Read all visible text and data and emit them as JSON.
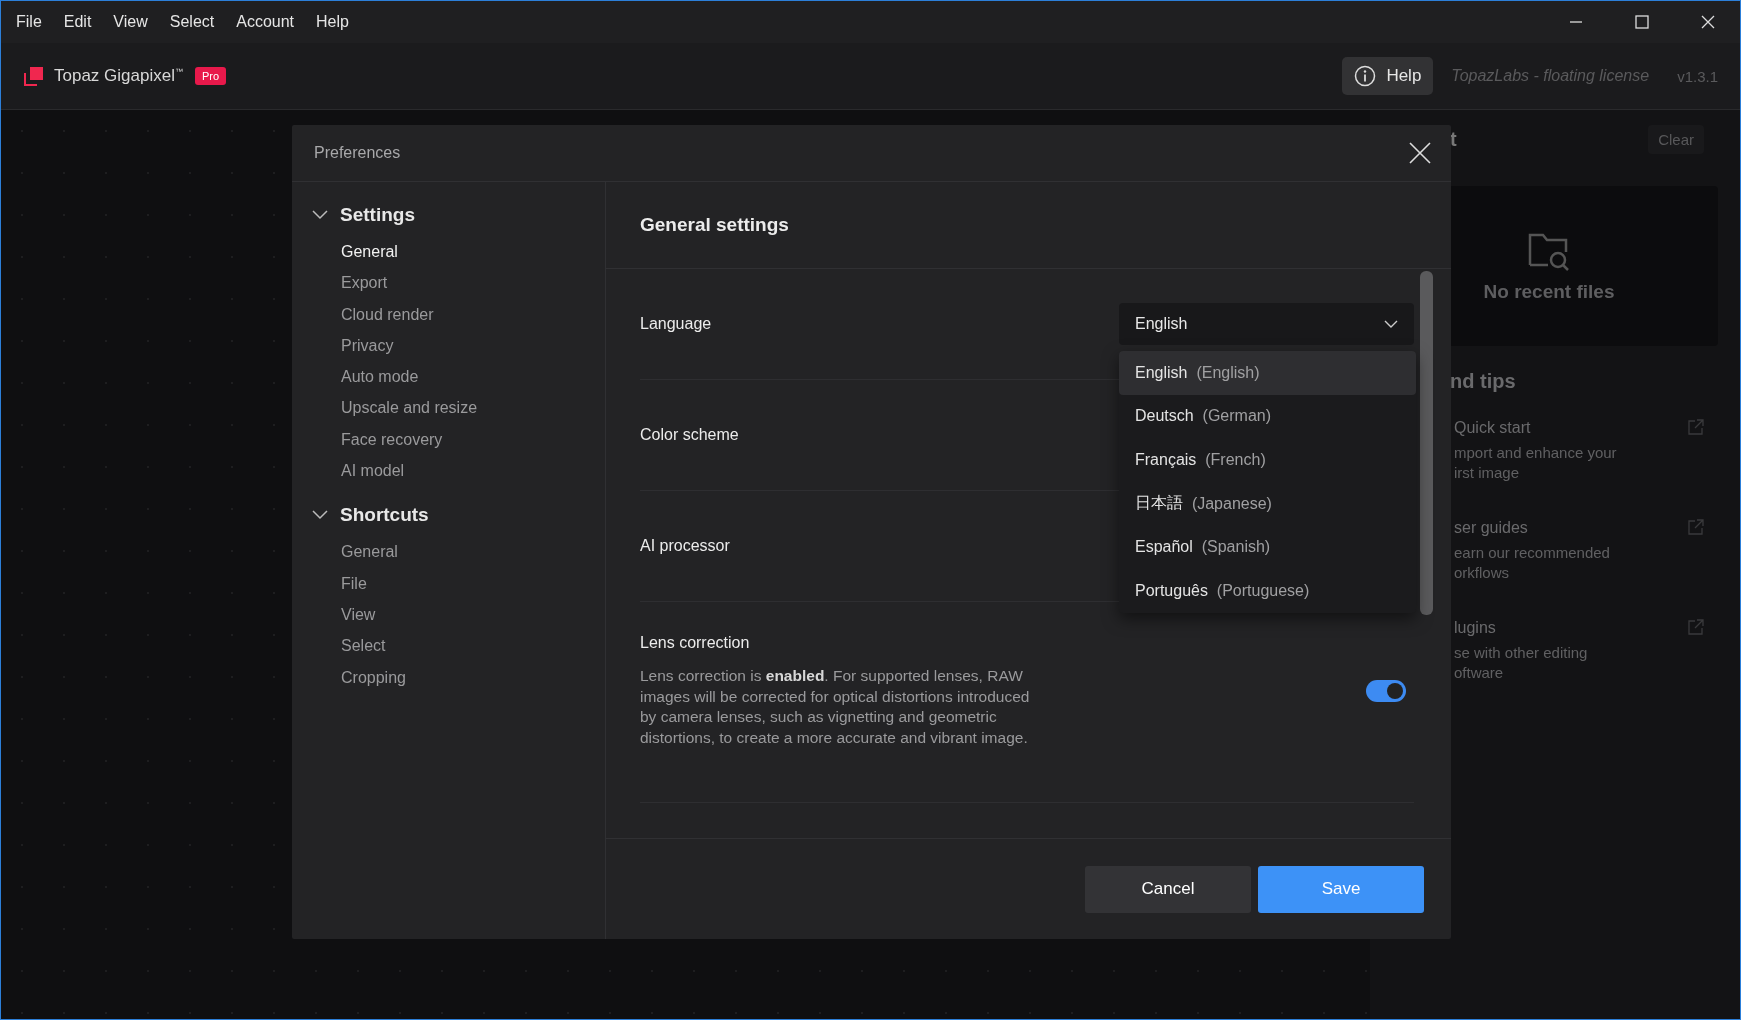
{
  "menu_bar": [
    "File",
    "Edit",
    "View",
    "Select",
    "Account",
    "Help"
  ],
  "app_header": {
    "app_name": "Topaz Gigapixel$^{™}$",
    "badge": "Pro",
    "help_button": "Help",
    "license": "TopazLabs - floating license",
    "version": "v1.3.1"
  },
  "side_panel": {
    "title": "t",
    "clear_button": "Clear",
    "empty_state": "No recent files",
    "section_title": "nd tips",
    "tips": [
      {
        "title": "Quick start",
        "description": "mport and enhance your irst image"
      },
      {
        "title": "ser guides",
        "description": "earn our recommended orkflows"
      },
      {
        "title": "lugins",
        "description": "se with other editing oftware"
      }
    ]
  },
  "dialog": {
    "title": "Preferences",
    "nav": [
      {
        "heading": "Settings",
        "expanded": true,
        "items": [
          {
            "label": "General",
            "selected": true
          },
          {
            "label": "Export",
            "selected": false
          },
          {
            "label": "Cloud render",
            "selected": false
          },
          {
            "label": "Privacy",
            "selected": false
          },
          {
            "label": "Auto mode",
            "selected": false
          },
          {
            "label": "Upscale and resize",
            "selected": false
          },
          {
            "label": "Face recovery",
            "selected": false
          },
          {
            "label": "AI model",
            "selected": false
          }
        ]
      },
      {
        "heading": "Shortcuts",
        "expanded": true,
        "items": [
          {
            "label": "General",
            "selected": false
          },
          {
            "label": "File",
            "selected": false
          },
          {
            "label": "View",
            "selected": false
          },
          {
            "label": "Select",
            "selected": false
          },
          {
            "label": "Cropping",
            "selected": false
          }
        ]
      }
    ],
    "content_title": "General settings",
    "settings": [
      {
        "kind": "dropdown",
        "label": "Language",
        "value": "English",
        "expanded": true,
        "options": [
          {
            "name": "English",
            "english": "(English)",
            "selected": true
          },
          {
            "name": "Deutsch",
            "english": "(German)",
            "selected": false
          },
          {
            "name": "Français",
            "english": "(French)",
            "selected": false
          },
          {
            "name": "日本語",
            "english": "(Japanese)",
            "selected": false
          },
          {
            "name": "Español",
            "english": "(Spanish)",
            "selected": false
          },
          {
            "name": "Português",
            "english": "(Portuguese)",
            "selected": false
          }
        ]
      },
      {
        "kind": "covered",
        "label": "Color scheme"
      },
      {
        "kind": "covered",
        "label": "AI processor"
      },
      {
        "kind": "toggle",
        "label": "Lens correction",
        "description": "Lens correction is **enabled**. For supported lenses, RAW images will be corrected for optical distortions introduced by camera lenses, such as vignetting and geometric distortions, to create a more accurate and vibrant image.",
        "on": true
      }
    ],
    "buttons": [
      {
        "label": "Cancel",
        "kind": "secondary"
      },
      {
        "label": "Save",
        "kind": "primary"
      }
    ]
  }
}
